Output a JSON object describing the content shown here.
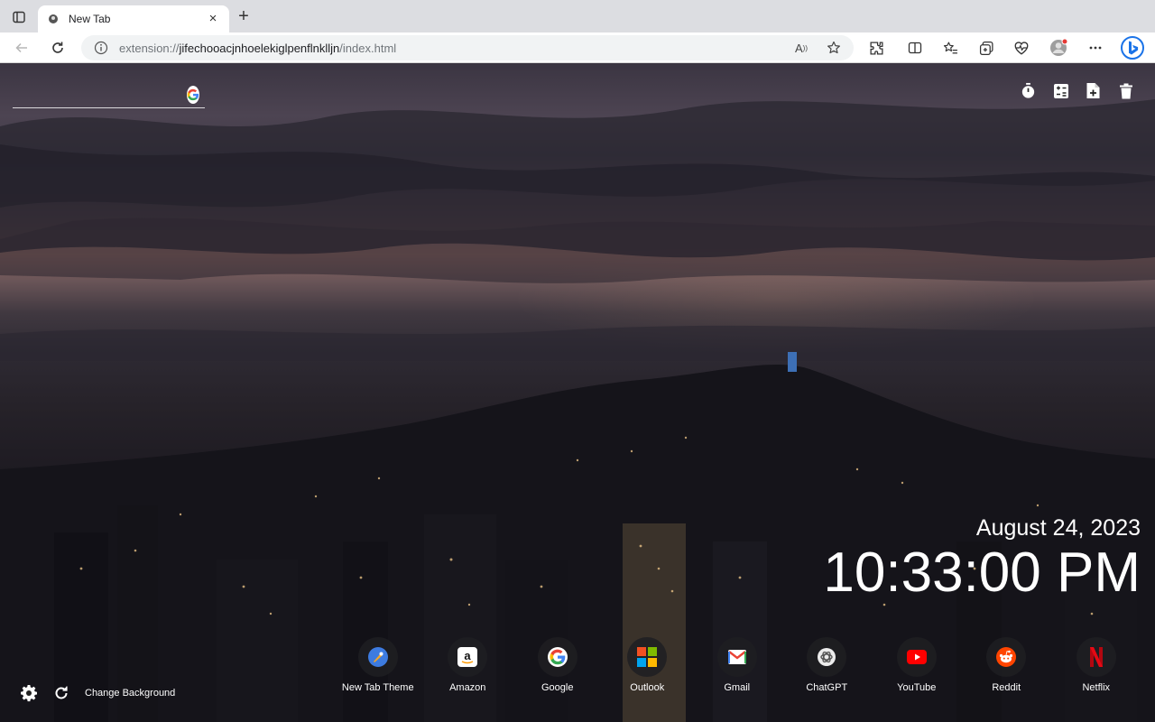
{
  "tab": {
    "title": "New Tab"
  },
  "address": {
    "scheme": "extension://",
    "host": "jifechooacjnhoelekiglpenflnklljn",
    "path": "/index.html"
  },
  "search": {
    "placeholder": ""
  },
  "clock": {
    "date": "August 24, 2023",
    "time": "10:33:00 PM"
  },
  "shortcuts": [
    {
      "label": "New Tab Theme",
      "icon": "new-tab-theme-icon"
    },
    {
      "label": "Amazon",
      "icon": "amazon-icon"
    },
    {
      "label": "Google",
      "icon": "google-icon"
    },
    {
      "label": "Outlook",
      "icon": "outlook-icon"
    },
    {
      "label": "Gmail",
      "icon": "gmail-icon"
    },
    {
      "label": "ChatGPT",
      "icon": "chatgpt-icon"
    },
    {
      "label": "YouTube",
      "icon": "youtube-icon"
    },
    {
      "label": "Reddit",
      "icon": "reddit-icon"
    },
    {
      "label": "Netflix",
      "icon": "netflix-icon"
    }
  ],
  "bottom": {
    "change_background": "Change Background"
  },
  "colors": {
    "accent": "#1a73e8",
    "youtube": "#ff0000",
    "netflix": "#e50914",
    "reddit": "#ff4500"
  }
}
